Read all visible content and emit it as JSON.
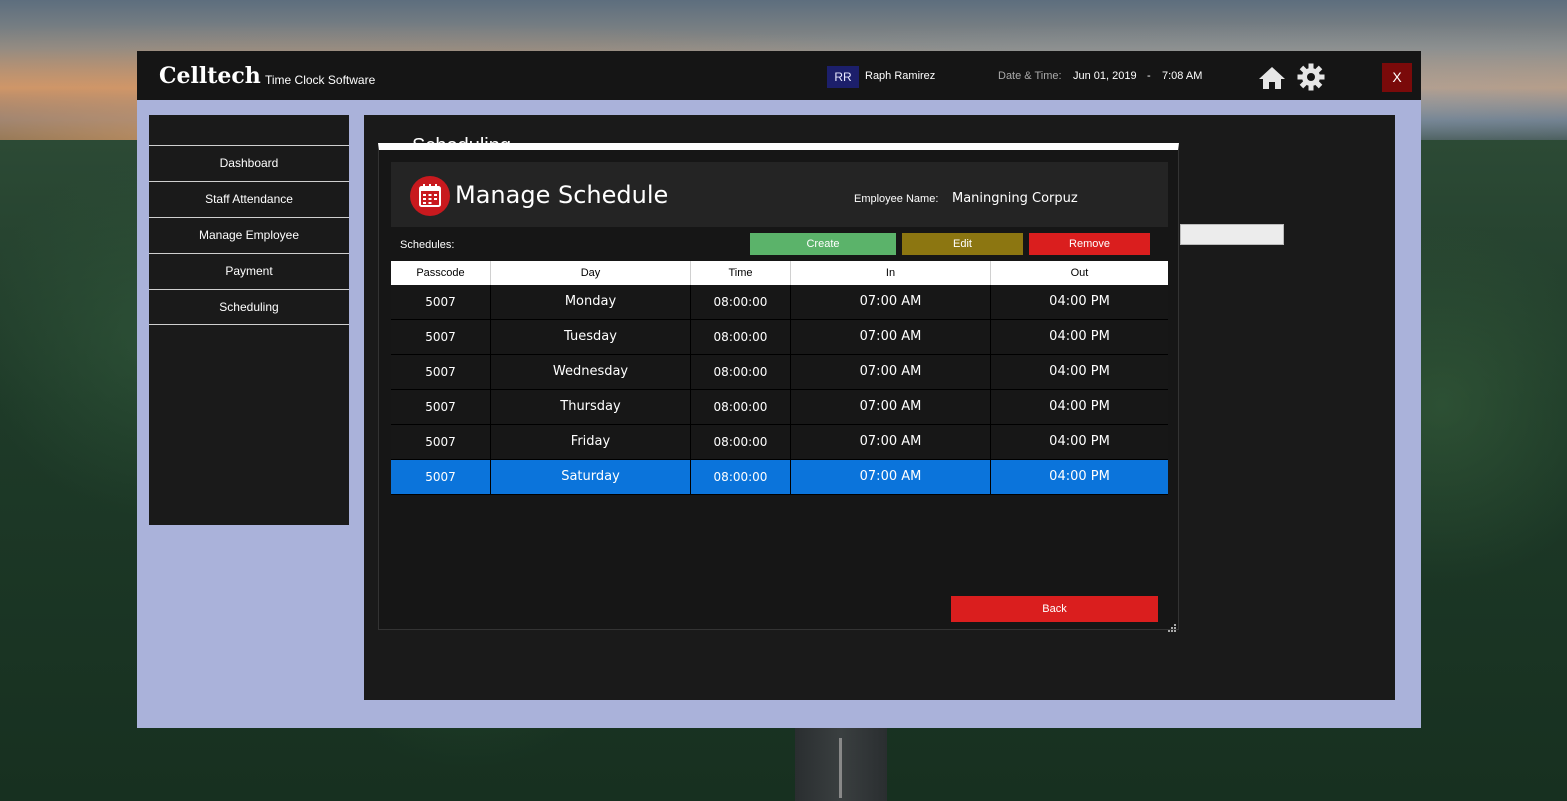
{
  "app": {
    "brand": "Celltech",
    "brand_sub": "Time Clock Software",
    "user_initials": "RR",
    "user_name": "Raph Ramirez",
    "datetime_label": "Date & Time:",
    "date": "Jun 01, 2019",
    "separator": "-",
    "time": "7:08 AM",
    "close_label": "X"
  },
  "sidebar": {
    "items": [
      {
        "label": "Dashboard"
      },
      {
        "label": "Staff Attendance"
      },
      {
        "label": "Manage Employee"
      },
      {
        "label": "Payment"
      },
      {
        "label": "Scheduling"
      }
    ]
  },
  "main": {
    "title": "Scheduling"
  },
  "dialog": {
    "title": "Manage Schedule",
    "employee_label": "Employee Name:",
    "employee_name": "Maningning Corpuz",
    "schedules_label": "Schedules:",
    "create_label": "Create",
    "edit_label": "Edit",
    "remove_label": "Remove",
    "back_label": "Back",
    "columns": [
      "Passcode",
      "Day",
      "Time",
      "In",
      "Out"
    ],
    "rows": [
      [
        "5007",
        "Monday",
        "08:00:00",
        "07:00 AM",
        "04:00 PM"
      ],
      [
        "5007",
        "Tuesday",
        "08:00:00",
        "07:00 AM",
        "04:00 PM"
      ],
      [
        "5007",
        "Wednesday",
        "08:00:00",
        "07:00 AM",
        "04:00 PM"
      ],
      [
        "5007",
        "Thursday",
        "08:00:00",
        "07:00 AM",
        "04:00 PM"
      ],
      [
        "5007",
        "Friday",
        "08:00:00",
        "07:00 AM",
        "04:00 PM"
      ],
      [
        "5007",
        "Saturday",
        "08:00:00",
        "07:00 AM",
        "04:00 PM"
      ]
    ],
    "selected_row": 5
  },
  "icons": {
    "home": "home-icon",
    "settings": "gear-icon",
    "calendar": "calendar-icon"
  },
  "colors": {
    "create": "#5bb36a",
    "edit": "#8c7611",
    "remove": "#da1e1e",
    "selected": "#0b74db",
    "frame": "#aab2da"
  }
}
